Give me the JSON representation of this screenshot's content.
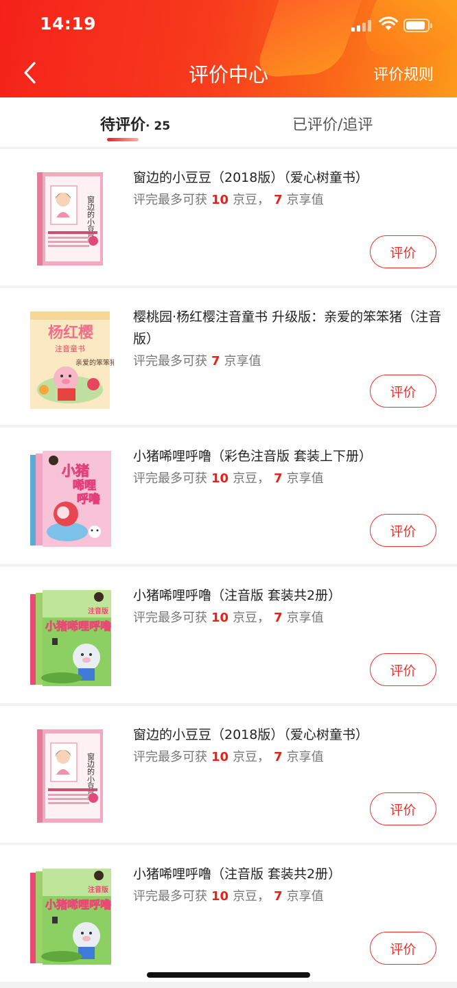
{
  "status_bar": {
    "time": "14:19",
    "battery_level": 0.9
  },
  "header": {
    "title": "评价中心",
    "rules_link": "评价规则",
    "colors": {
      "gradient_start": "#f5221b",
      "gradient_end": "#fd9a1a"
    }
  },
  "tabs": {
    "pending_label": "待评价",
    "pending_count": "· 25",
    "done_label": "已评价/追评",
    "active": "pending"
  },
  "items": [
    {
      "title": "窗边的小豆豆（2018版）（爱心树童书）",
      "reward_prefix": "评完最多可获",
      "beans": "10",
      "beans_unit": "京豆，",
      "points": "7",
      "points_unit": "京享值",
      "button": "评价",
      "cover": "window-girl-book"
    },
    {
      "title": "樱桃园·杨红樱注音童书 升级版：亲爱的笨笨猪（注音版）",
      "reward_prefix": "评完最多可获",
      "points": "7",
      "points_unit": "京享值",
      "button": "评价",
      "cover": "pig-yanghongying-book"
    },
    {
      "title": "小猪唏哩呼噜（彩色注音版 套装上下册）",
      "reward_prefix": "评完最多可获",
      "beans": "10",
      "beans_unit": "京豆，",
      "points": "7",
      "points_unit": "京享值",
      "button": "评价",
      "cover": "pink-pig-book-set"
    },
    {
      "title": "小猪唏哩呼噜（注音版 套装共2册）",
      "reward_prefix": "评完最多可获",
      "beans": "10",
      "beans_unit": "京豆，",
      "points": "7",
      "points_unit": "京享值",
      "button": "评价",
      "cover": "green-pig-book-set"
    },
    {
      "title": "窗边的小豆豆（2018版）（爱心树童书）",
      "reward_prefix": "评完最多可获",
      "beans": "10",
      "beans_unit": "京豆，",
      "points": "7",
      "points_unit": "京享值",
      "button": "评价",
      "cover": "window-girl-book"
    },
    {
      "title": "小猪唏哩呼噜（注音版 套装共2册）",
      "reward_prefix": "评完最多可获",
      "beans": "10",
      "beans_unit": "京豆，",
      "points": "7",
      "points_unit": "京享值",
      "button": "评价",
      "cover": "green-pig-book-set"
    }
  ],
  "cover_text": {
    "window_title": "窗边的小豆豆",
    "yang_brand": "杨红樱",
    "yang_series": "注音童书",
    "yang_subtitle": "亲爱的笨笨猪",
    "pig_title_1": "小猪",
    "pig_title_2": "唏哩",
    "pig_title_3": "呼噜",
    "green_tag": "注音版",
    "green_title": "小猪唏哩呼噜"
  }
}
